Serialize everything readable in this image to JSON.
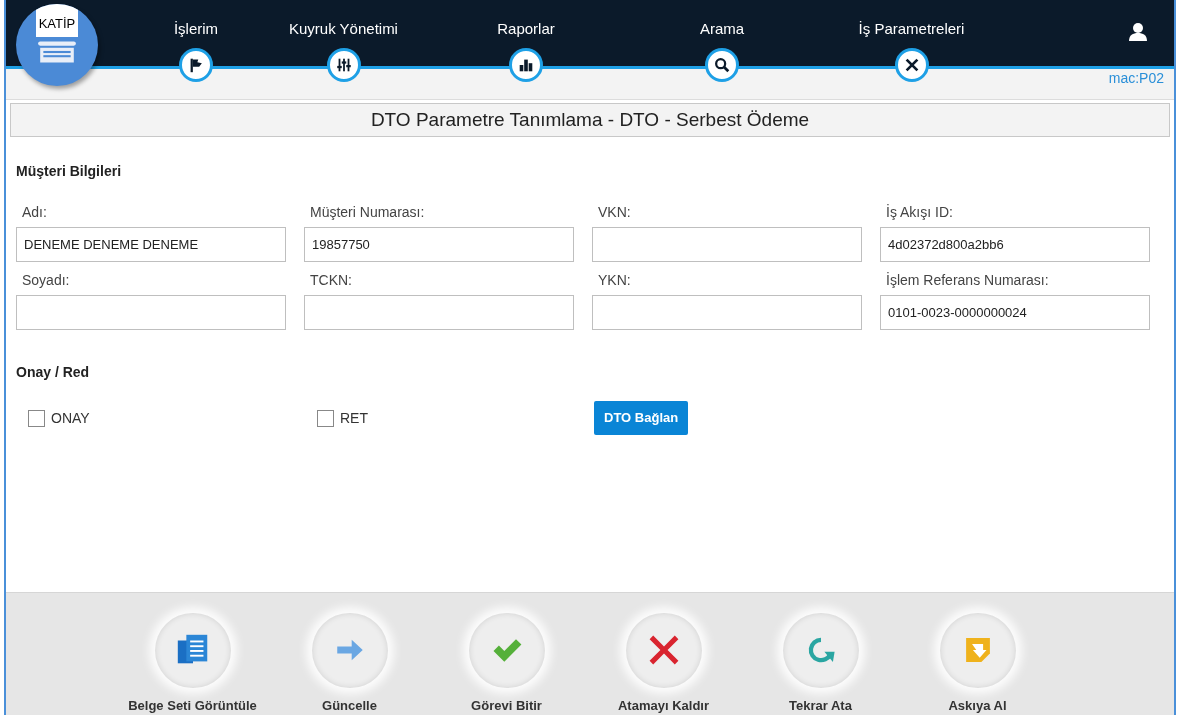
{
  "header": {
    "logo": "KATİP",
    "nav": [
      {
        "label": "İşlerim"
      },
      {
        "label": "Kuyruk Yönetimi"
      },
      {
        "label": "Raporlar"
      },
      {
        "label": "Arama"
      },
      {
        "label": "İş Parametreleri"
      }
    ],
    "machine": "mac:P02"
  },
  "page_title": "DTO Parametre Tanımlama - DTO - Serbest Ödeme",
  "customer_section": {
    "title": "Müşteri Bilgileri",
    "fields": [
      {
        "label": "Adı:",
        "value": "DENEME DENEME DENEME"
      },
      {
        "label": "Müşteri Numarası:",
        "value": "19857750"
      },
      {
        "label": "VKN:"
      },
      {
        "label": "İş Akışı ID:",
        "value": "4d02372d800a2bb6"
      },
      {
        "label": "Soyadı:"
      },
      {
        "label": "TCKN:"
      },
      {
        "label": "YKN:"
      },
      {
        "label": "İşlem Referans Numarası:",
        "value": "0101-0023-0000000024"
      }
    ]
  },
  "approval_section": {
    "title": "Onay / Red",
    "options": [
      {
        "label": "ONAY",
        "checked": false
      },
      {
        "label": "RET",
        "checked": false
      }
    ],
    "button": "DTO Bağlan"
  },
  "actions": [
    {
      "label": "Belge Seti Görüntüle"
    },
    {
      "label": "Güncelle"
    },
    {
      "label": "Görevi Bitir"
    },
    {
      "label": "Atamayı Kaldır"
    },
    {
      "label": "Tekrar Ata"
    },
    {
      "label": "Askıya Al"
    }
  ]
}
